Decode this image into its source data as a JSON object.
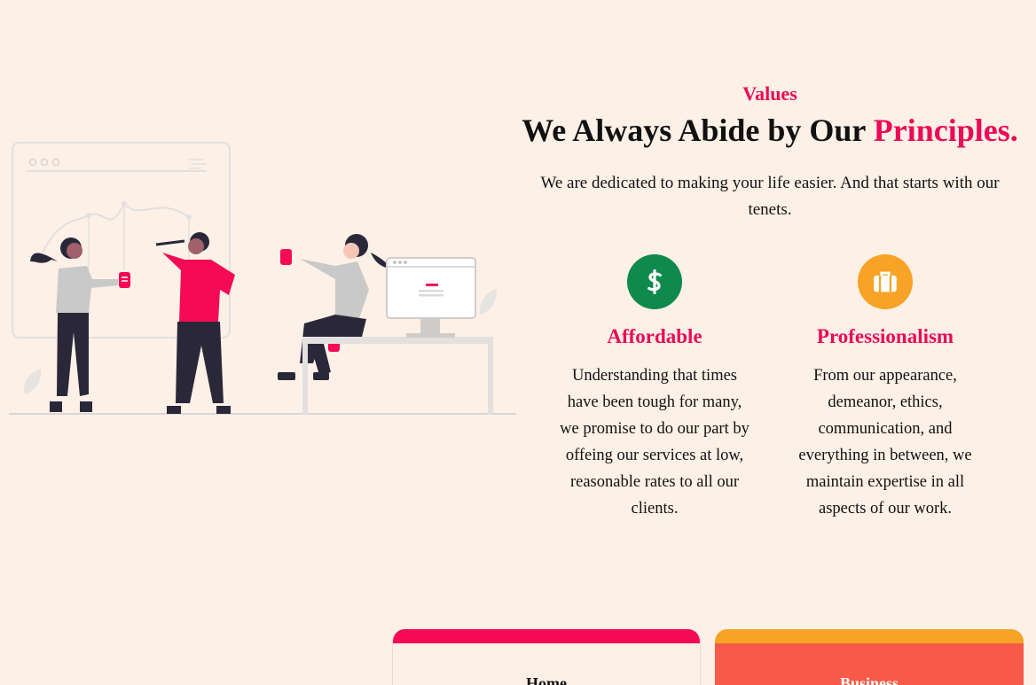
{
  "section": {
    "eyebrow": "Values",
    "headline_main": "We Always Abide by Our ",
    "headline_accent": "Principles.",
    "lead": "We are dedicated to making your life easier. And that starts with our tenets."
  },
  "values": [
    {
      "icon": "dollar-icon",
      "color": "#0f8a4c",
      "title": "Affordable",
      "text": "Understanding that times have been tough for many, we promise to do our part by offeing our services at low, reasonable rates to all our clients."
    },
    {
      "icon": "briefcase-icon",
      "color": "#f7a326",
      "title": "Professionalism",
      "text": "From our appearance, demeanor, ethics, communication, and everything in between, we maintain expertise in all aspects of our work."
    }
  ],
  "plans": [
    {
      "name": "Home",
      "accent": "#f50a55"
    },
    {
      "name": "Business",
      "accent": "#f7a326"
    }
  ],
  "colors": {
    "background": "#fdf0e6",
    "accent": "#ea0a57",
    "illustration_shirt": "#f50a55",
    "illustration_pants": "#2a2838",
    "illustration_hair": "#2a2838",
    "illustration_gray": "#c9c9c9"
  }
}
